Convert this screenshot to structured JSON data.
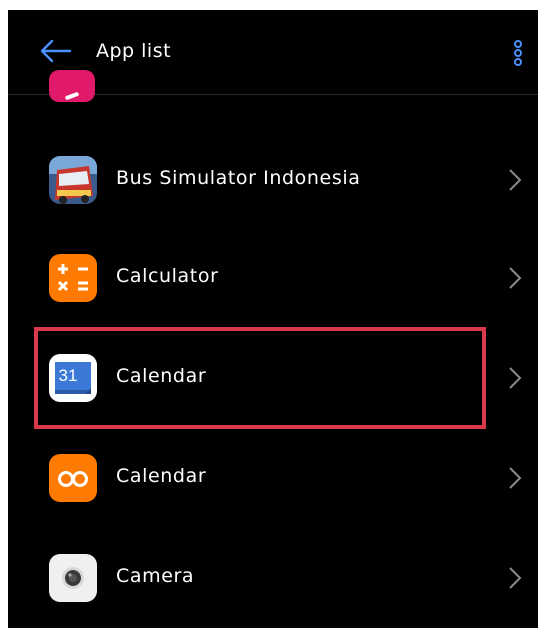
{
  "header": {
    "title": "App list",
    "back_icon": "arrow-left-icon",
    "more_icon": "more-vertical-icon",
    "accent": "#4a90ff"
  },
  "apps": [
    {
      "label": "Bus Simulator Indonesia",
      "icon": "bus-simulator-icon"
    },
    {
      "label": "Calculator",
      "icon": "calculator-icon",
      "color": "#ff7a00"
    },
    {
      "label": "Calendar",
      "icon": "google-calendar-icon",
      "number": "31",
      "color": "#3c78d8"
    },
    {
      "label": "Calendar",
      "icon": "infinity-calendar-icon",
      "color": "#ff7a00"
    },
    {
      "label": "Camera",
      "icon": "camera-icon"
    }
  ],
  "highlight_color": "#d83a4a"
}
